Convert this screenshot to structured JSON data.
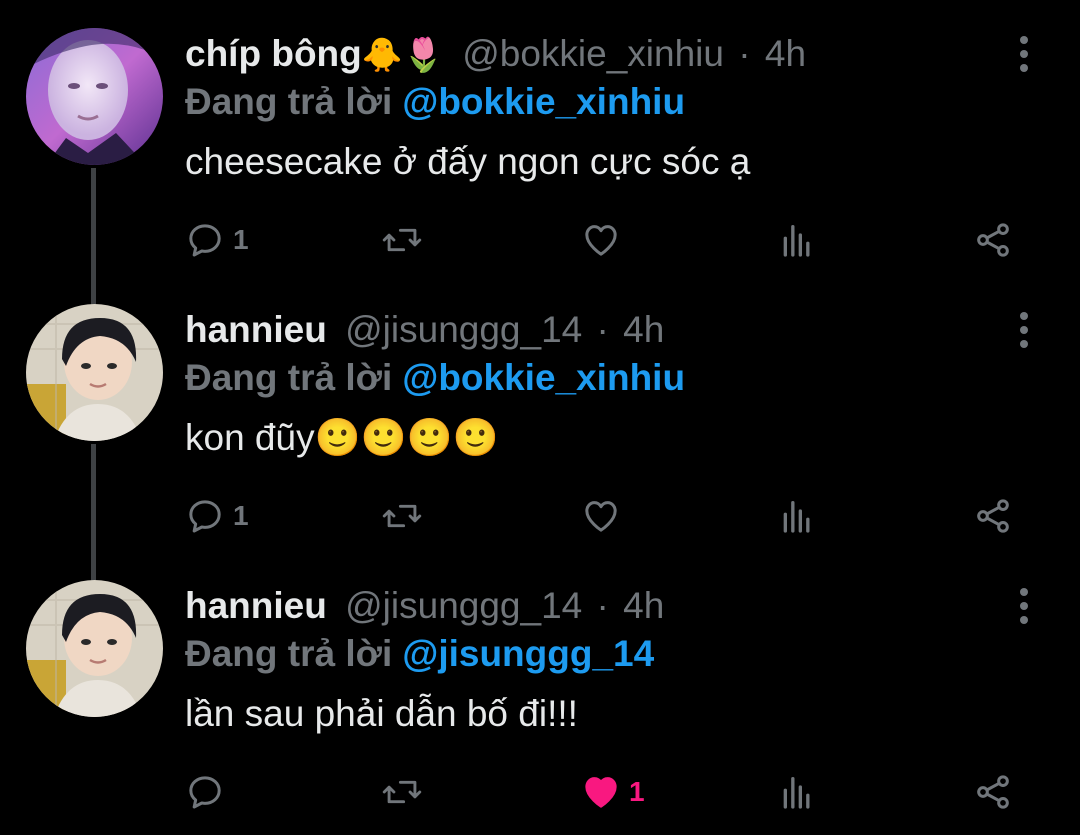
{
  "colors": {
    "background": "#000000",
    "text": "#e7e9ea",
    "muted": "#71767b",
    "link": "#1d9bf0",
    "like": "#f91880",
    "thread_line": "#3e4144"
  },
  "reply_prefix": "Đang trả lời",
  "tweets": [
    {
      "display_name": "chíp bông",
      "name_emoji": "🐥🌷",
      "handle": "@bokkie_xinhiu",
      "separator": "·",
      "time": "4h",
      "reply_to": "@bokkie_xinhiu",
      "text": "cheesecake ở đấy ngon cực sóc ạ",
      "reply_count": "1",
      "like_count": "",
      "liked": false,
      "avatar": "masked-face-portrait"
    },
    {
      "display_name": "hannieu",
      "name_emoji": "",
      "handle": "@jisunggg_14",
      "separator": "·",
      "time": "4h",
      "reply_to": "@bokkie_xinhiu",
      "text": "kon đũy🙂🙂🙂🙂",
      "reply_count": "1",
      "like_count": "",
      "liked": false,
      "avatar": "boy-portrait"
    },
    {
      "display_name": "hannieu",
      "name_emoji": "",
      "handle": "@jisunggg_14",
      "separator": "·",
      "time": "4h",
      "reply_to": "@jisunggg_14",
      "text": "lần sau phải dẫn bố đi!!!",
      "reply_count": "",
      "like_count": "1",
      "liked": true,
      "avatar": "boy-portrait"
    }
  ]
}
